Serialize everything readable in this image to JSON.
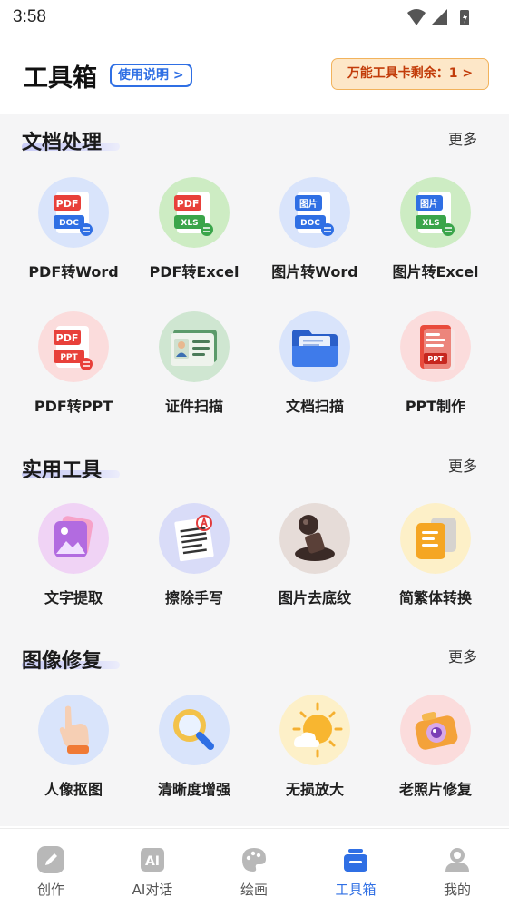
{
  "status_bar": {
    "time": "3:58"
  },
  "header": {
    "title": "工具箱",
    "help_link": "使用说明 >",
    "card_badge": "万能工具卡剩余：1 >"
  },
  "sections": [
    {
      "title": "文档处理",
      "more": "更多",
      "tools": [
        {
          "label": "PDF转Word",
          "icon": "pdf-to-word-icon"
        },
        {
          "label": "PDF转Excel",
          "icon": "pdf-to-excel-icon"
        },
        {
          "label": "图片转Word",
          "icon": "image-to-word-icon"
        },
        {
          "label": "图片转Excel",
          "icon": "image-to-excel-icon"
        },
        {
          "label": "PDF转PPT",
          "icon": "pdf-to-ppt-icon"
        },
        {
          "label": "证件扫描",
          "icon": "id-card-scan-icon"
        },
        {
          "label": "文档扫描",
          "icon": "folder-scan-icon"
        },
        {
          "label": "PPT制作",
          "icon": "ppt-maker-icon"
        }
      ]
    },
    {
      "title": "实用工具",
      "more": "更多",
      "tools": [
        {
          "label": "文字提取",
          "icon": "text-extract-icon"
        },
        {
          "label": "擦除手写",
          "icon": "erase-handwriting-icon"
        },
        {
          "label": "图片去底纹",
          "icon": "stamp-icon"
        },
        {
          "label": "简繁体转换",
          "icon": "simplified-traditional-icon"
        }
      ]
    },
    {
      "title": "图像修复",
      "more": "更多",
      "tools": [
        {
          "label": "人像抠图",
          "icon": "portrait-cutout-icon"
        },
        {
          "label": "清晰度增强",
          "icon": "magnifier-icon"
        },
        {
          "label": "无损放大",
          "icon": "sun-cloud-icon"
        },
        {
          "label": "老照片修复",
          "icon": "camera-icon"
        }
      ]
    }
  ],
  "icon_text": {
    "pdf": "PDF",
    "doc": "DOC",
    "xls": "XLS",
    "img": "图片",
    "ppt": "PPT",
    "ai": "AI"
  },
  "bottom_nav": {
    "items": [
      {
        "label": "创作",
        "icon": "pencil-icon",
        "active": false
      },
      {
        "label": "AI对话",
        "icon": "ai-chat-icon",
        "active": false
      },
      {
        "label": "绘画",
        "icon": "palette-icon",
        "active": false
      },
      {
        "label": "工具箱",
        "icon": "toolbox-icon",
        "active": true
      },
      {
        "label": "我的",
        "icon": "user-icon",
        "active": false
      }
    ]
  },
  "colors": {
    "accent": "#2f6fe4",
    "badge_bg": "#fde7c8",
    "badge_text": "#c23c0a",
    "section_bg": "#f5f5f6"
  }
}
